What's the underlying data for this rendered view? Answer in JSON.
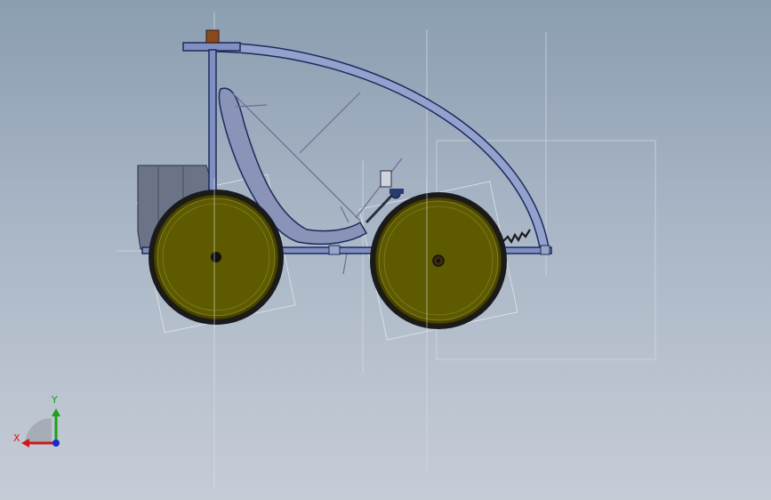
{
  "triad": {
    "x_label": "X",
    "y_label": "Y",
    "x_color": "#d01818",
    "y_color": "#1aa01a",
    "z_color": "#1a2ad0"
  },
  "colors": {
    "background_top": "#8b9db1",
    "background_bottom": "#c6ccd6",
    "frame": "#1e2a5c",
    "frame_fill": "#7f8fc0",
    "canopy_fill": "#93a2cc",
    "wheel_fill": "#5e5a00",
    "wheel_tire": "#1a1a1a",
    "seat_fill": "#8a93b8",
    "battery_fill": "#6b7386",
    "construction_line": "#d8dde5",
    "accent_brown": "#8a4a20"
  }
}
